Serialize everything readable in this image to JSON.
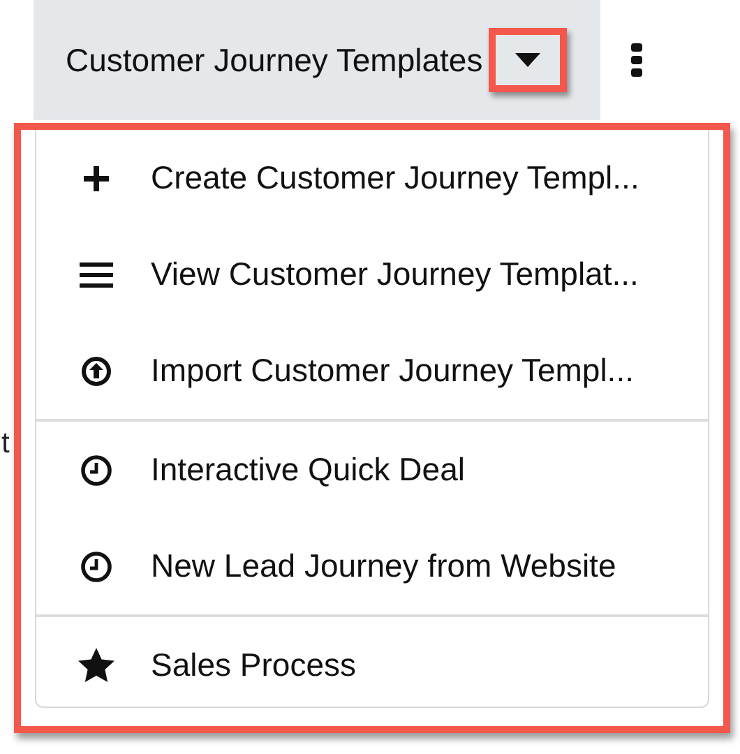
{
  "header": {
    "title": "Customer Journey Templates",
    "dropdown_highlighted": true
  },
  "background_fragment": "t",
  "menu": {
    "highlighted": true,
    "sections": [
      [
        {
          "kind": "create",
          "label": "Create Customer Journey Templ..."
        },
        {
          "kind": "view",
          "label": "View Customer Journey Templat..."
        },
        {
          "kind": "import",
          "label": "Import Customer Journey Templ..."
        }
      ],
      [
        {
          "kind": "journey",
          "label": "Interactive Quick Deal"
        },
        {
          "kind": "journey",
          "label": "New Lead Journey from Website"
        }
      ],
      [
        {
          "kind": "process",
          "label": "Sales Process"
        }
      ]
    ]
  }
}
